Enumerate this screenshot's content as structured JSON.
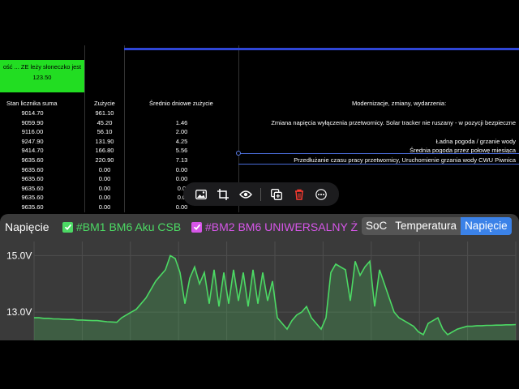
{
  "sheet": {
    "green_cell": {
      "line1": "ość ... ZE leży słoneczko jest",
      "line2": "123.50"
    },
    "headers": [
      "Stan licznika suma",
      "Zużycie",
      "Średnio dniowe zużycie",
      "Modernizacje, zmiany, wydarzenia:"
    ],
    "rows": [
      [
        "9014.70",
        "961.10",
        "",
        ""
      ],
      [
        "9059.90",
        "45.20",
        "1.46",
        "Zmiana napięcia wyłączenia przetwornicy. Solar tracker nie ruszany - w pozycji bezpieczne"
      ],
      [
        "9116.00",
        "56.10",
        "2.00",
        ""
      ],
      [
        "9247.90",
        "131.90",
        "4.25",
        "Ładna pogoda / grzanie wody"
      ],
      [
        "9414.70",
        "166.80",
        "5.56",
        "Średnia pogoda przez połowę miesiąca"
      ],
      [
        "9635.60",
        "220.90",
        "7.13",
        "Przedłużanie czasu pracy przetwornicy, Uruchomienie grzania wody CWU Piwnica"
      ],
      [
        "9635.60",
        "0.00",
        "0.00",
        ""
      ],
      [
        "9635.60",
        "0.00",
        "0.00",
        ""
      ],
      [
        "9635.60",
        "0.00",
        "0.0",
        ""
      ],
      [
        "9635.60",
        "0.00",
        "0.0",
        ""
      ],
      [
        "9635.60",
        "0.00",
        "0.00",
        ""
      ],
      [
        "9635.60",
        "0.00",
        "0.00",
        ""
      ]
    ]
  },
  "toolbar": {
    "icons": [
      "image-icon",
      "crop-icon",
      "eye-icon",
      "duplicate-icon",
      "trash-icon",
      "more-icon"
    ]
  },
  "panel": {
    "title": "Napięcie",
    "legend": [
      {
        "label": "#BM1 BM6 Aku CSB",
        "color": "#4cd964",
        "checked": true
      },
      {
        "label": "#BM2 BM6 UNIWERSALNY Ż",
        "color": "#d656e8",
        "checked": true
      }
    ],
    "tabs": [
      {
        "label": "SoC",
        "active": false
      },
      {
        "label": "Temperatura",
        "active": false
      },
      {
        "label": "Napięcie",
        "active": true
      }
    ]
  },
  "chart_data": {
    "type": "line",
    "ylabels": [
      "15.0V",
      "13.0V"
    ],
    "ylim": [
      12.0,
      15.5
    ],
    "grid": true,
    "series": [
      {
        "color": "#4cd964",
        "values": [
          12.8,
          12.8,
          12.78,
          12.78,
          12.76,
          12.76,
          12.75,
          12.74,
          12.74,
          12.72,
          12.72,
          12.71,
          12.7,
          12.7,
          12.68,
          12.66,
          12.65,
          12.64,
          12.8,
          12.9,
          13.0,
          13.1,
          13.3,
          13.5,
          13.8,
          14.1,
          14.3,
          14.5,
          15.0,
          14.9,
          14.4,
          13.3,
          14.2,
          14.6,
          14.0,
          14.4,
          13.3,
          14.5,
          13.2,
          14.4,
          13.3,
          14.5,
          13.4,
          14.4,
          13.2,
          14.5,
          13.3,
          14.4,
          13.4,
          14.1,
          12.8,
          12.6,
          12.4,
          12.7,
          12.9,
          13.0,
          13.2,
          12.8,
          12.6,
          12.4,
          12.8,
          14.4,
          14.7,
          14.6,
          14.5,
          13.4,
          14.8,
          14.3,
          14.6,
          14.8,
          13.2,
          14.5,
          14.0,
          13.5,
          13.0,
          12.8,
          12.7,
          12.6,
          12.5,
          12.3,
          12.2,
          12.6,
          12.7,
          12.8,
          12.4,
          12.2,
          12.3,
          12.4,
          12.45,
          12.5,
          12.5,
          12.52,
          12.52,
          12.53,
          12.53,
          12.54,
          12.54,
          12.55,
          12.55,
          12.56
        ]
      }
    ]
  }
}
